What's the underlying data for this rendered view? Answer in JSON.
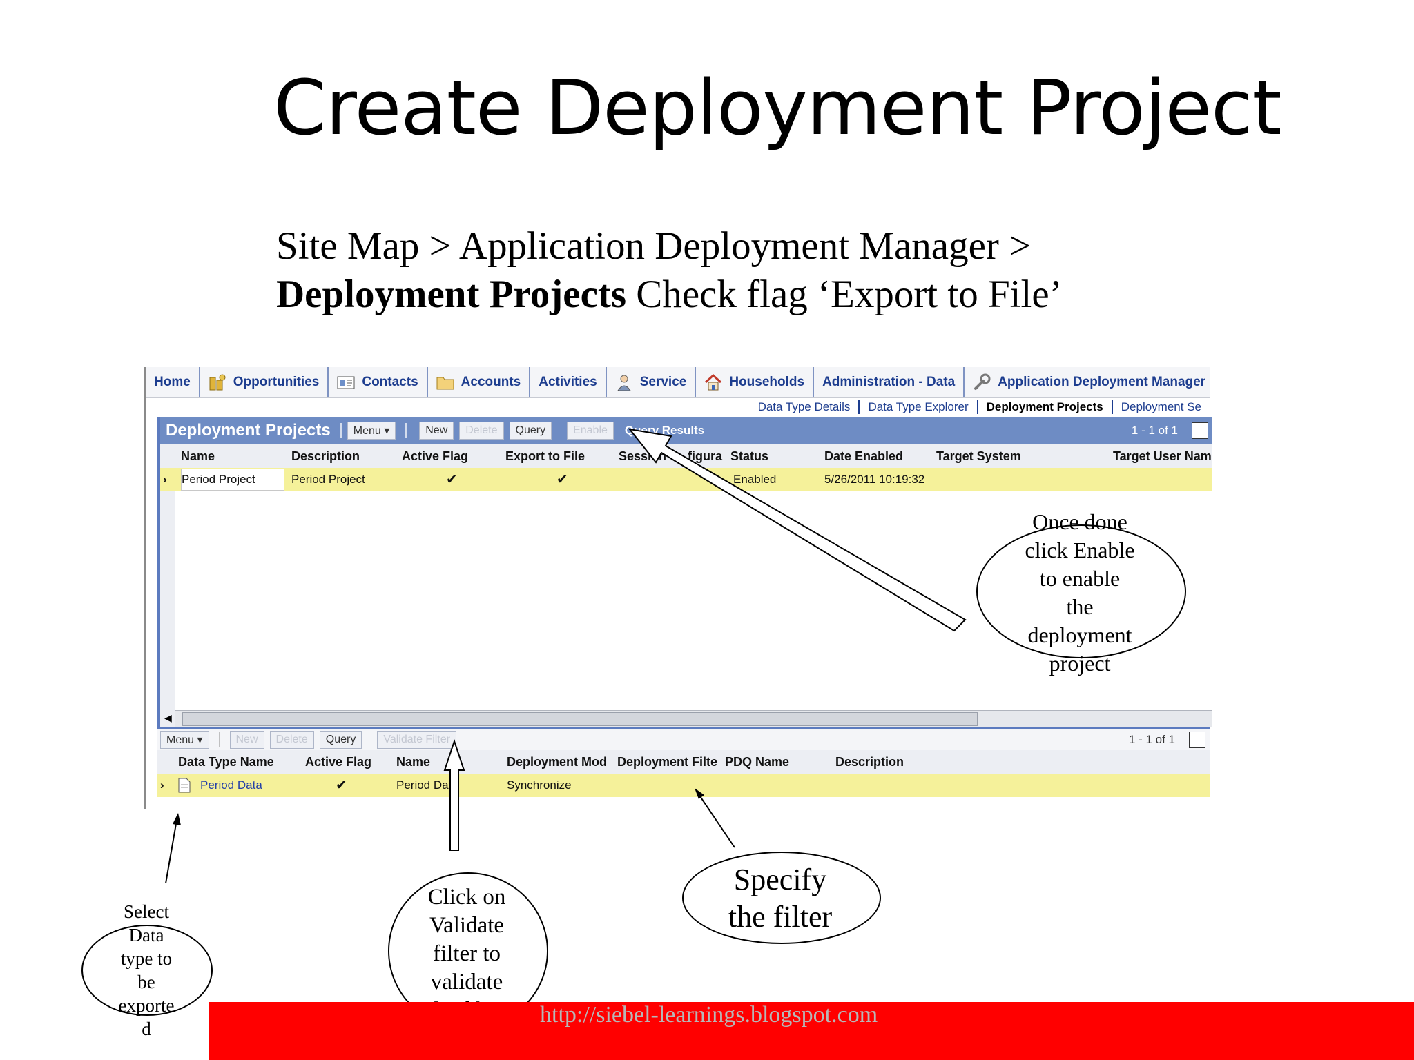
{
  "slide": {
    "title": "Create Deployment Project",
    "subtitle_line1": "Site Map > Application Deployment Manager >",
    "subtitle_bold": "Deployment Projects",
    "subtitle_rest": " Check flag ‘Export to File’",
    "footer_url": "http://siebel-learnings.blogspot.com"
  },
  "tabs": [
    {
      "label": "Home",
      "icon": ""
    },
    {
      "label": "Opportunities",
      "icon": "coins-icon"
    },
    {
      "label": "Contacts",
      "icon": "contact-card-icon"
    },
    {
      "label": "Accounts",
      "icon": "folder-icon"
    },
    {
      "label": "Activities",
      "icon": ""
    },
    {
      "label": "Service",
      "icon": "person-icon"
    },
    {
      "label": "Households",
      "icon": "house-icon"
    },
    {
      "label": "Administration - Data",
      "icon": ""
    },
    {
      "label": "Application Deployment Manager",
      "icon": "wrench-icon"
    }
  ],
  "subtabs": [
    {
      "label": "Data Type Details"
    },
    {
      "label": "Data Type Explorer"
    },
    {
      "label": "Deployment Projects"
    },
    {
      "label": "Deployment Se"
    }
  ],
  "applet1": {
    "title": "Deployment Projects",
    "menu": "Menu ▾",
    "new": "New",
    "delete": "Delete",
    "query": "Query",
    "enable": "Enable",
    "query_results": "Query Results",
    "count": "1 - 1 of 1",
    "columns": [
      "Name",
      "Description",
      "Active Flag",
      "Export to File",
      "Session",
      "figura",
      "Status",
      "Date Enabled",
      "Target System",
      "Target User Nam"
    ],
    "row": {
      "name": "Period Project",
      "description": "Period Project",
      "active_flag": "✔",
      "export_to_file": "✔",
      "status": "Enabled",
      "date_enabled": "5/26/2011 10:19:32"
    }
  },
  "applet2": {
    "menu": "Menu ▾",
    "new": "New",
    "delete": "Delete",
    "query": "Query",
    "validate": "Validate Filter",
    "count": "1 - 1 of 1",
    "columns": [
      "Data Type Name",
      "Active Flag",
      "Name",
      "Deployment Mod",
      "Deployment Filte",
      "PDQ Name",
      "Description"
    ],
    "row": {
      "data_type_name": "Period Data",
      "active_flag": "✔",
      "name": "Period Dat",
      "deployment_mode": "Synchronize"
    }
  },
  "notes": {
    "enable_lines": [
      "Once done",
      "click Enable",
      "to enable",
      "the",
      "deployment",
      "project"
    ],
    "validate_lines": [
      "Click on",
      "Validate",
      "filter to",
      "validate",
      "the filter"
    ],
    "filter_lines": [
      "Specify",
      "the filter"
    ],
    "select_lines": [
      "Select",
      "Data",
      "type to",
      "be",
      "exporte",
      "d"
    ]
  }
}
